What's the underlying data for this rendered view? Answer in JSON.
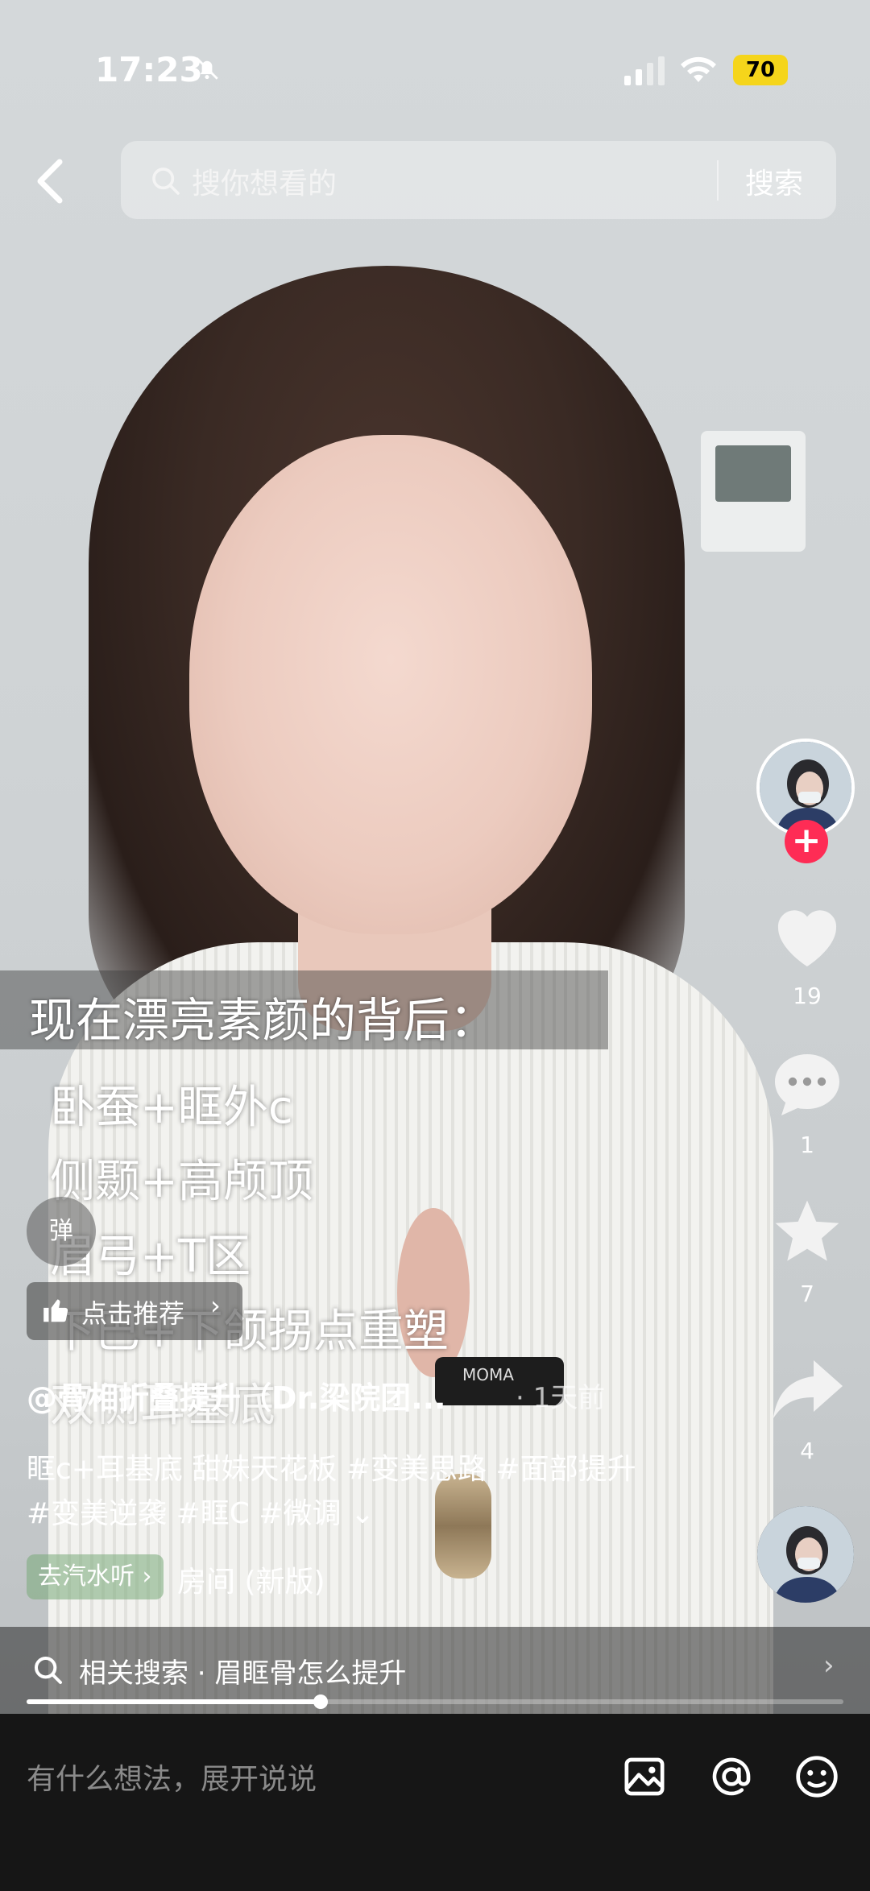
{
  "status_bar": {
    "time": "17:23",
    "battery": "70"
  },
  "search": {
    "placeholder": "搜你想看的",
    "button": "搜索"
  },
  "video": {
    "caption_title": "现在漂亮素颜的背后：",
    "caption_lines": [
      "卧蚕+眶外c",
      "侧颞+高颅顶",
      "眉弓+T区",
      "下巴+下颌拐点重塑",
      "双侧耳基底"
    ],
    "mic_label": "MOMA"
  },
  "danmu_label": "弹",
  "recommend": {
    "label": "点击推荐",
    "arrow": "›"
  },
  "post": {
    "author": "@骨相折叠提升（Dr.梁院团...",
    "time": "· 1天前",
    "desc_line1": "眶c+耳基底 甜妹天花板 #变美思路 #面部提升",
    "desc_line2": "#变美逆袭 #眶C #微调 ⌄",
    "music_tag": "去汽水听 ›",
    "music_title": "房间 (新版)"
  },
  "actions": {
    "likes": "19",
    "comments": "1",
    "favorites": "7",
    "shares": "4"
  },
  "related": {
    "label": "相关搜索 · 眉眶骨怎么提升",
    "arrow": "›"
  },
  "progress": {
    "value": 0.36
  },
  "comment_bar": {
    "placeholder": "有什么想法，展开说说"
  },
  "colors": {
    "follow": "#fe2c55",
    "battery": "#f5d51b"
  }
}
